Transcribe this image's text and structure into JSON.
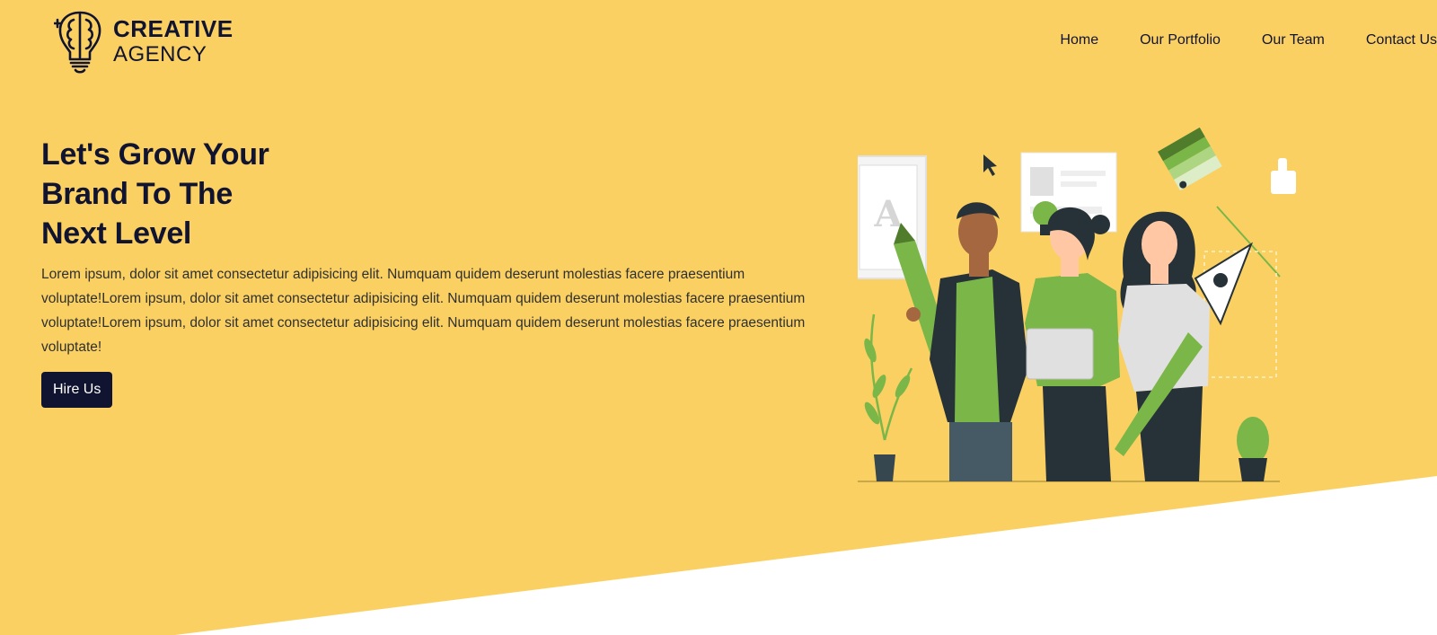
{
  "brand": {
    "line1": "CREATIVE",
    "line2": "AGENCY",
    "icon": "brain-lightbulb-icon"
  },
  "nav": {
    "items": [
      {
        "label": "Home"
      },
      {
        "label": "Our Portfolio"
      },
      {
        "label": "Our Team"
      },
      {
        "label": "Contact Us"
      }
    ]
  },
  "hero": {
    "title_line1": "Let's Grow Your",
    "title_line2": "Brand To The",
    "title_line3": "Next Level",
    "description": "Lorem ipsum, dolor sit amet consectetur adipisicing elit. Numquam quidem deserunt molestias facere praesentium voluptate!Lorem ipsum, dolor sit amet consectetur adipisicing elit. Numquam quidem deserunt molestias facere praesentium voluptate!Lorem ipsum, dolor sit amet consectetur adipisicing elit. Numquam quidem deserunt molestias facere praesentium voluptate!",
    "cta_label": "Hire Us",
    "illustration": "team-illustration"
  },
  "colors": {
    "background": "#fbd062",
    "primary_dark": "#111430",
    "accent_green": "#7ab648"
  }
}
